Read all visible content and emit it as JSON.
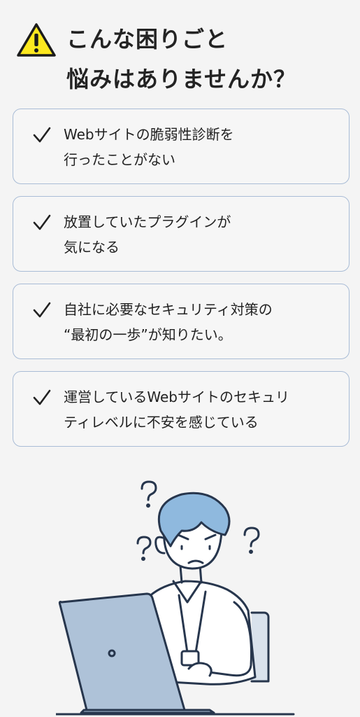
{
  "header": {
    "icon": "warning-icon",
    "title_line1": "こんな困りごと",
    "title_line2": "悩みはありませんか？"
  },
  "items": [
    {
      "icon": "check-icon",
      "line1": "Webサイトの脆弱性診断を",
      "line2": "行ったことがない"
    },
    {
      "icon": "check-icon",
      "line1": "放置していたプラグインが",
      "line2": "気になる"
    },
    {
      "icon": "check-icon",
      "line1": "自社に必要なセキュリティ対策の",
      "line2": "“最初の一歩”が知りたい。"
    },
    {
      "icon": "check-icon",
      "line1": "運営しているWebサイトのセキュリ",
      "line2": "ティレベルに不安を感じている"
    }
  ],
  "illustration": {
    "name": "worried-person-laptop-illustration"
  },
  "colors": {
    "background": "#f4f4f4",
    "card_border": "#a9bcd6",
    "warning_yellow": "#fde81f",
    "hair_blue": "#8fb9de",
    "outline_navy": "#27364d"
  }
}
